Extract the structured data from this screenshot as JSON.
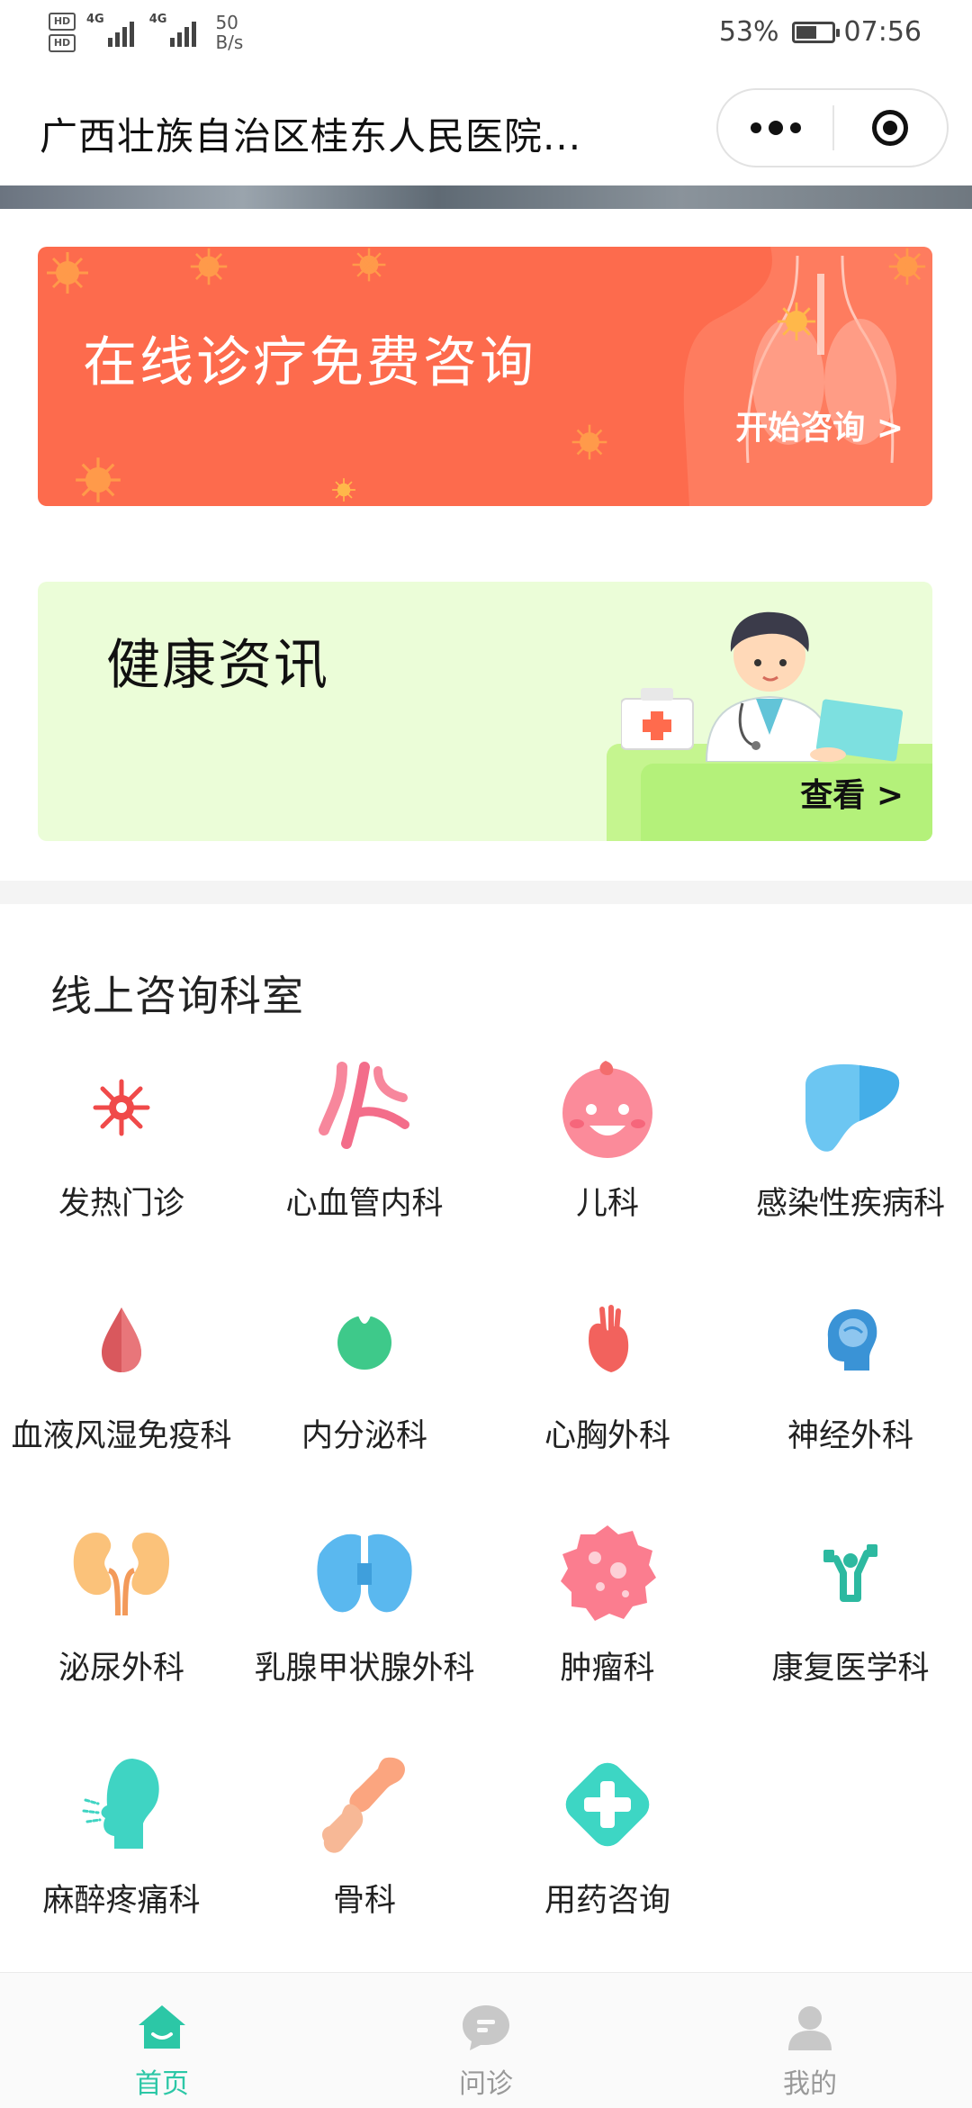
{
  "status_bar": {
    "hd1": "HD",
    "hd2": "HD",
    "net1": "4G",
    "net2": "4G",
    "speed_value": "50",
    "speed_unit": "B/s",
    "battery": "53%",
    "time": "07:56",
    "battery_level": 0.53
  },
  "header": {
    "title": "广西壮族自治区桂东人民医院...",
    "more_icon": "more-dots-icon",
    "close_icon": "target-circle-icon"
  },
  "banners": {
    "consult": {
      "title": "在线诊疗免费咨询",
      "cta": "开始咨询 >",
      "bg_color": "#fd6b4d"
    },
    "news": {
      "title": "健康资讯",
      "cta": "查看 >",
      "bg_color": "#ebfdd8"
    }
  },
  "departments": {
    "title": "线上咨询科室",
    "items": [
      {
        "label": "发热门诊",
        "icon": "fever-virus-icon"
      },
      {
        "label": "心血管内科",
        "icon": "blood-vessel-icon"
      },
      {
        "label": "儿科",
        "icon": "baby-face-icon"
      },
      {
        "label": "感染性疾病科",
        "icon": "liver-icon"
      },
      {
        "label": "血液风湿免疫科",
        "icon": "blood-drop-icon"
      },
      {
        "label": "内分泌科",
        "icon": "endocrine-gland-icon"
      },
      {
        "label": "心胸外科",
        "icon": "heart-icon"
      },
      {
        "label": "神经外科",
        "icon": "brain-head-icon"
      },
      {
        "label": "泌尿外科",
        "icon": "kidney-icon"
      },
      {
        "label": "乳腺甲状腺外科",
        "icon": "thyroid-icon"
      },
      {
        "label": "肿瘤科",
        "icon": "tumor-cell-icon"
      },
      {
        "label": "康复医学科",
        "icon": "rehab-exercise-icon"
      },
      {
        "label": "麻醉疼痛科",
        "icon": "anesthesia-head-icon"
      },
      {
        "label": "骨科",
        "icon": "bone-joint-icon"
      },
      {
        "label": "用药咨询",
        "icon": "medicine-plus-icon"
      }
    ]
  },
  "tabbar": {
    "items": [
      {
        "label": "首页",
        "icon": "home-icon",
        "active": true
      },
      {
        "label": "问诊",
        "icon": "chat-bubble-icon",
        "active": false
      },
      {
        "label": "我的",
        "icon": "user-icon",
        "active": false
      }
    ],
    "active_color": "#2cc7a6"
  }
}
